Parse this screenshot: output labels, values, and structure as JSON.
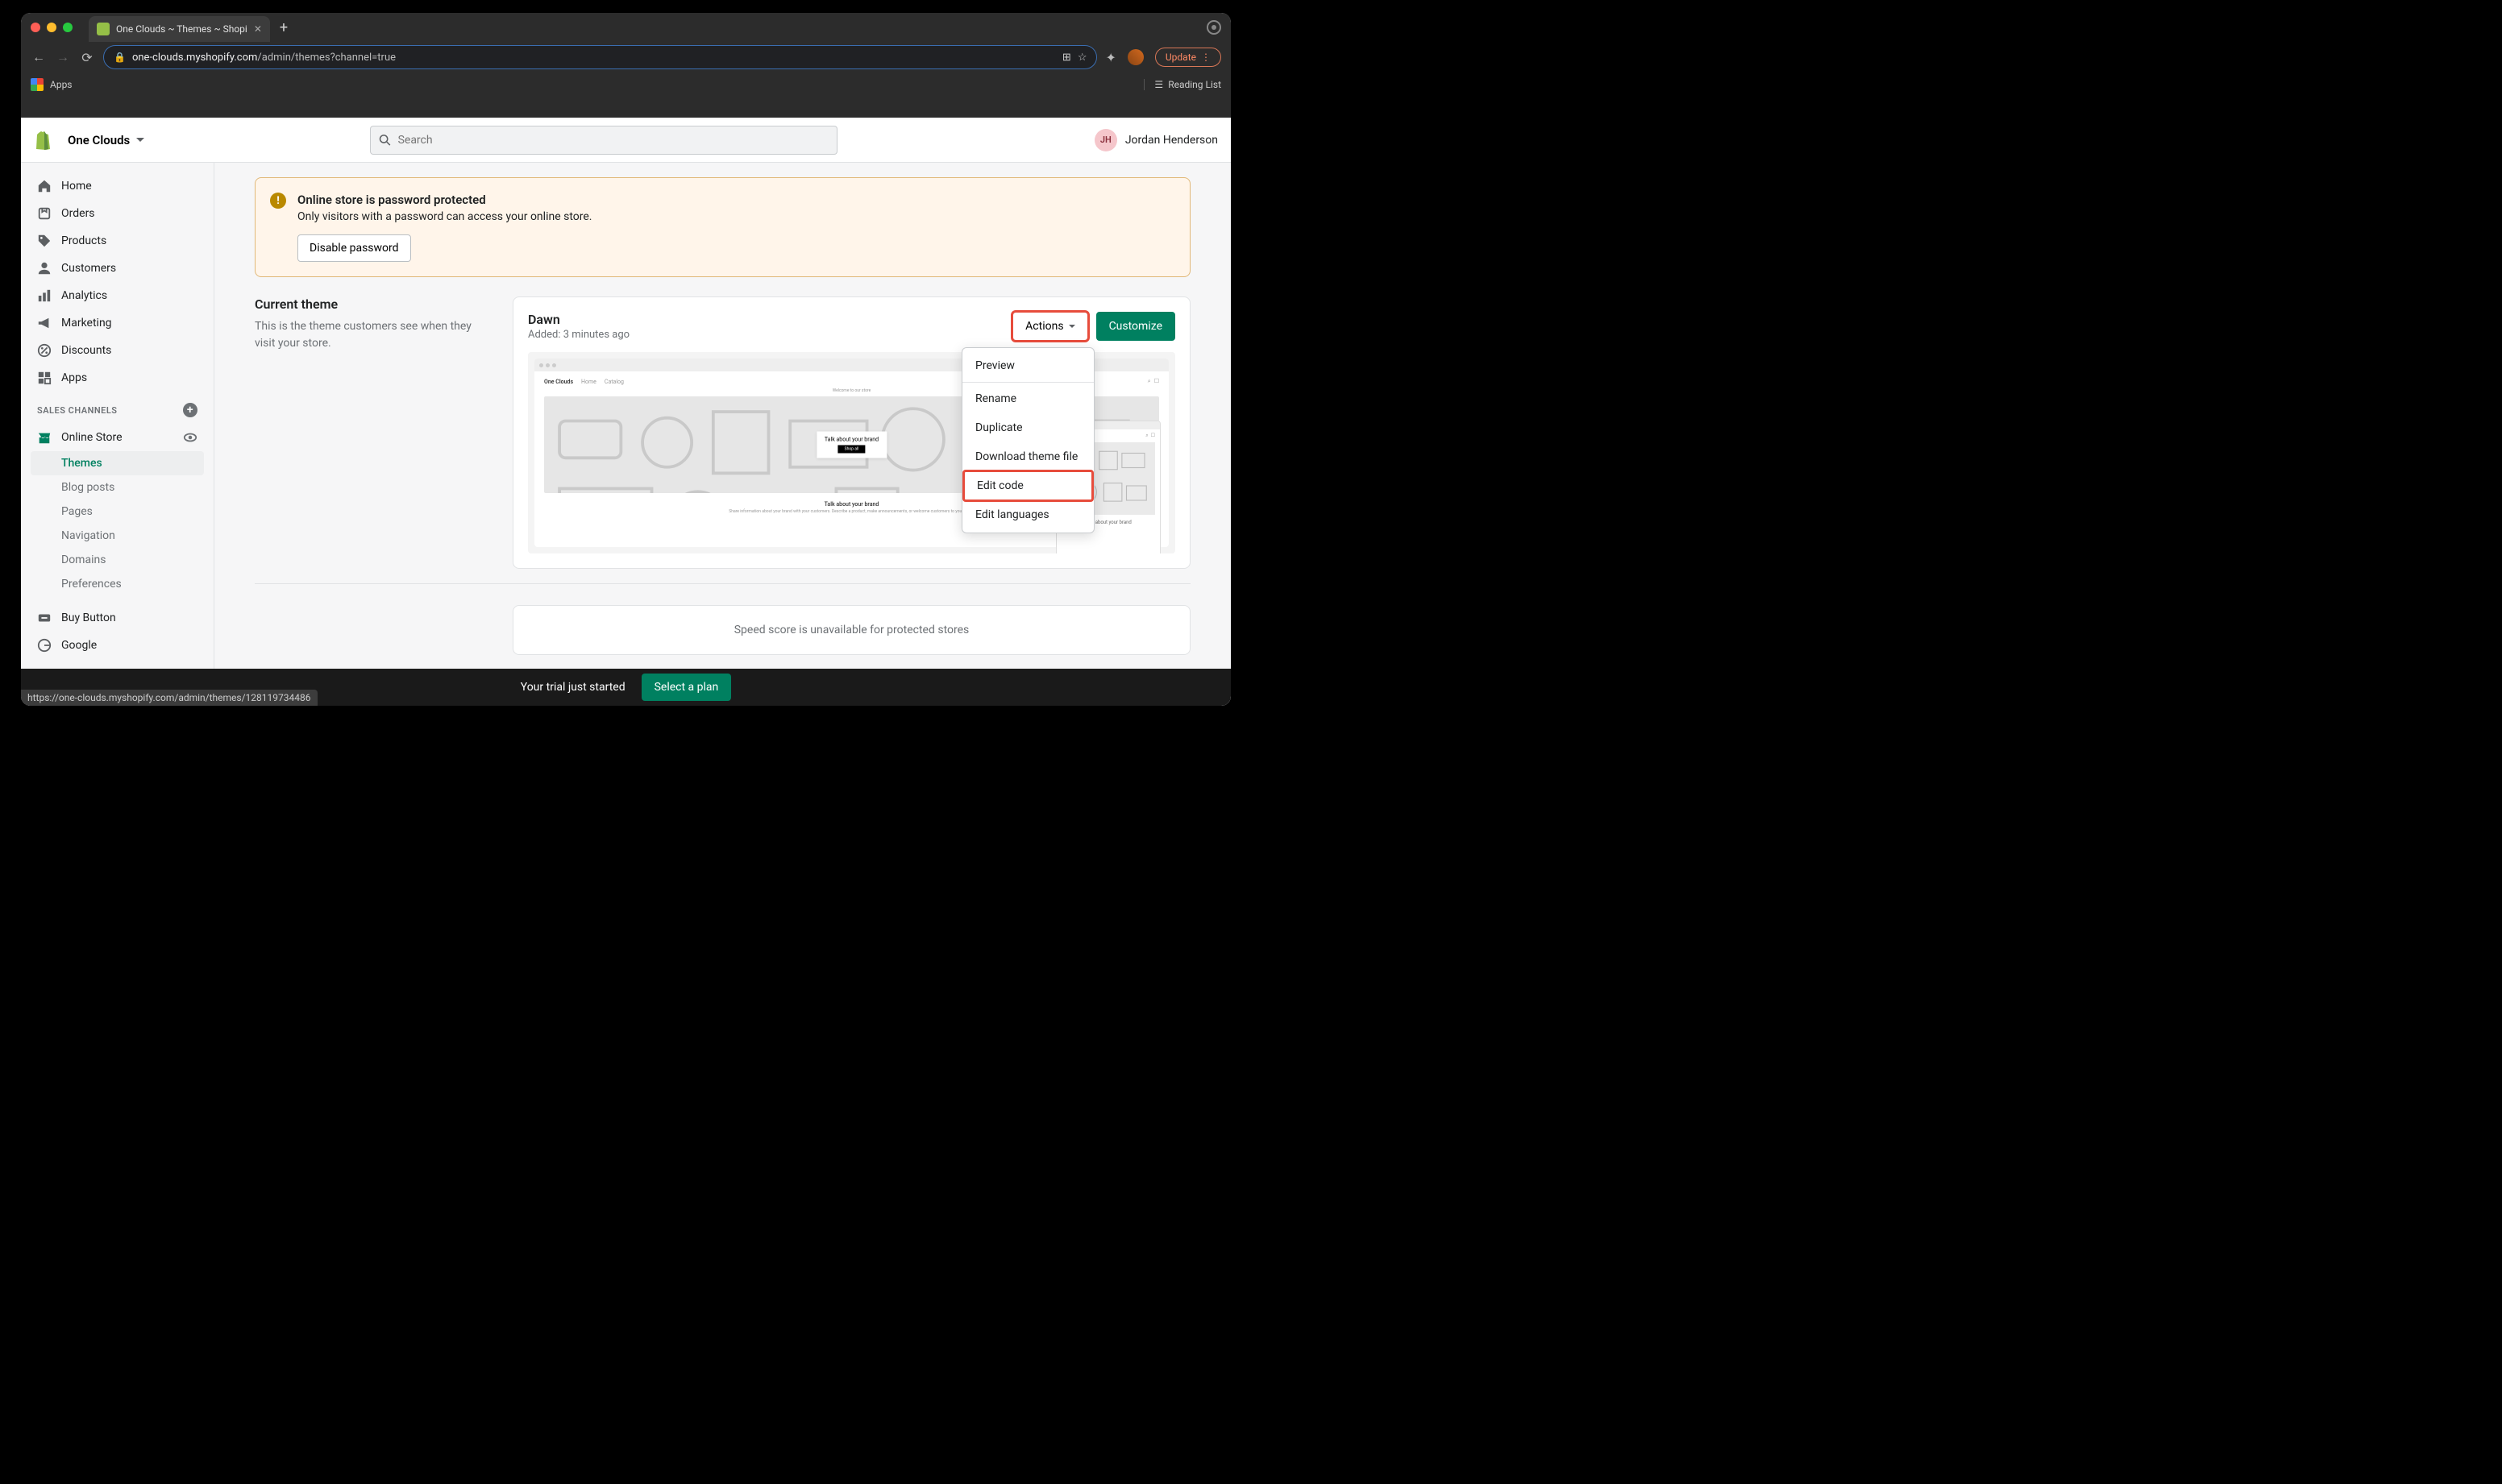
{
  "browser": {
    "tab_title": "One Clouds ~ Themes ~ Shopi",
    "url_host": "one-clouds.myshopify.com",
    "url_path": "/admin/themes?channel=true",
    "update_label": "Update",
    "apps_label": "Apps",
    "reading_list_label": "Reading List",
    "status_url": "https://one-clouds.myshopify.com/admin/themes/128119734486"
  },
  "topbar": {
    "shop_name": "One Clouds",
    "search_placeholder": "Search",
    "user_initials": "JH",
    "user_name": "Jordan Henderson"
  },
  "sidebar": {
    "items": [
      {
        "label": "Home"
      },
      {
        "label": "Orders"
      },
      {
        "label": "Products"
      },
      {
        "label": "Customers"
      },
      {
        "label": "Analytics"
      },
      {
        "label": "Marketing"
      },
      {
        "label": "Discounts"
      },
      {
        "label": "Apps"
      }
    ],
    "channels_header": "SALES CHANNELS",
    "online_store_label": "Online Store",
    "online_store_subs": [
      {
        "label": "Themes",
        "active": true
      },
      {
        "label": "Blog posts"
      },
      {
        "label": "Pages"
      },
      {
        "label": "Navigation"
      },
      {
        "label": "Domains"
      },
      {
        "label": "Preferences"
      }
    ],
    "buy_button_label": "Buy Button",
    "google_label": "Google"
  },
  "banner": {
    "title": "Online store is password protected",
    "text": "Only visitors with a password can access your online store.",
    "button": "Disable password"
  },
  "theme": {
    "section_title": "Current theme",
    "section_desc": "This is the theme customers see when they visit your store.",
    "name": "Dawn",
    "added": "Added: 3 minutes ago",
    "actions_label": "Actions",
    "customize_label": "Customize",
    "preview_brand_text": "Talk about your brand",
    "preview_shop_btn": "Shop all",
    "preview_brand": "One Clouds",
    "preview_nav_home": "Home",
    "preview_nav_catalog": "Catalog"
  },
  "dropdown": {
    "items": [
      "Preview",
      "Rename",
      "Duplicate",
      "Download theme file",
      "Edit code",
      "Edit languages"
    ]
  },
  "speed": {
    "text": "Speed score is unavailable for protected stores"
  },
  "trial": {
    "text": "Your trial just started",
    "button": "Select a plan"
  }
}
